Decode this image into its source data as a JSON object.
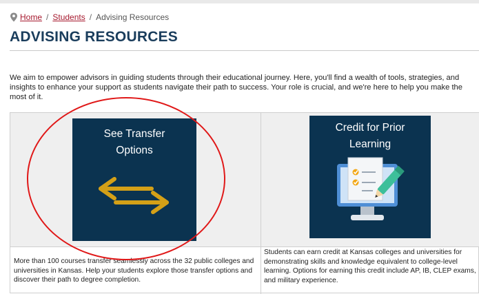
{
  "breadcrumb": {
    "home": "Home",
    "students": "Students",
    "current": "Advising Resources",
    "separator": "/"
  },
  "page": {
    "title": "ADVISING RESOURCES",
    "intro": "We aim to empower advisors in guiding students through their educational journey. Here, you'll find a wealth of tools, strategies, and insights to enhance your support as students navigate their path to success. Your role is crucial, and we're here to help you make the most of it."
  },
  "cards": {
    "transfer": {
      "tile_line1": "See Transfer",
      "tile_line2": "Options",
      "icon": "left-right-arrows-icon",
      "description": "More than 100 courses transfer seamlessly across the 32 public colleges and universities in Kansas. Help your students explore those transfer options and discover their path to degree completion."
    },
    "cpl": {
      "tile_line1": "Credit for Prior",
      "tile_line2": "Learning",
      "icon": "checklist-monitor-icon",
      "description": "Students can earn credit at Kansas colleges and universities for demonstrating skills and knowledge equivalent to college-level learning. Options for earning this credit include AP, IB, CLEP exams, and military experience."
    }
  },
  "colors": {
    "title": "#1a3d5c",
    "link": "#a6192e",
    "tile_bg": "#0b3350",
    "arrow": "#d4a017",
    "annotation": "#e01818"
  }
}
